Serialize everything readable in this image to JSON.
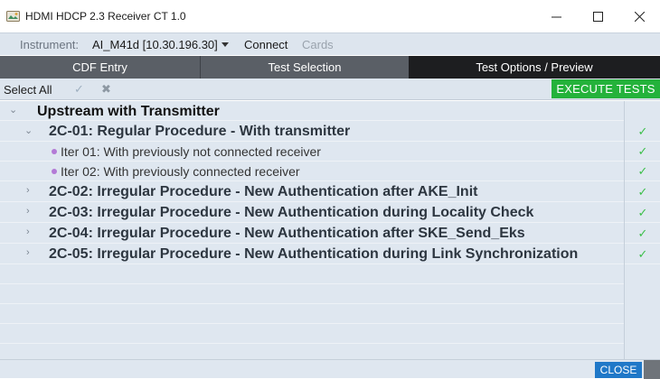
{
  "window": {
    "title": "HDMI HDCP 2.3 Receiver CT 1.0",
    "minimize_glyph": "—",
    "maximize_glyph": "☐",
    "close_glyph": "✕"
  },
  "instrument_bar": {
    "label": "Instrument:",
    "value": "AI_M41d [10.30.196.30]",
    "connect_label": "Connect",
    "cards_label": "Cards"
  },
  "tabs": [
    {
      "label": "CDF Entry"
    },
    {
      "label": "Test Selection"
    },
    {
      "label": "Test Options / Preview"
    }
  ],
  "toolbar": {
    "select_all_label": "Select All",
    "check_glyph": "✓",
    "x_glyph": "✖",
    "execute_label": "EXECUTE TESTS"
  },
  "tree": {
    "group": {
      "chevron": "⌄",
      "label": "Upstream with Transmitter"
    },
    "items": [
      {
        "chevron": "⌄",
        "label": "2C-01: Regular Procedure - With transmitter",
        "status": "✓"
      },
      {
        "bullet": true,
        "label": "Iter 01: With previously not connected receiver",
        "status": "✓"
      },
      {
        "bullet": true,
        "label": "Iter 02: With previously connected receiver",
        "status": "✓"
      },
      {
        "chevron": "›",
        "label": "2C-02: Irregular Procedure - New Authentication after AKE_Init",
        "status": "✓"
      },
      {
        "chevron": "›",
        "label": "2C-03: Irregular Procedure - New Authentication during Locality Check",
        "status": "✓"
      },
      {
        "chevron": "›",
        "label": "2C-04: Irregular Procedure - New Authentication after SKE_Send_Eks",
        "status": "✓"
      },
      {
        "chevron": "›",
        "label": "2C-05: Irregular Procedure - New Authentication during Link Synchronization",
        "status": "✓"
      }
    ]
  },
  "footer": {
    "close_label": "CLOSE"
  },
  "colors": {
    "execute_green": "#24b23b",
    "close_blue": "#1f78c8",
    "check_green": "#3cbf4a",
    "active_tab": "#1d1e20",
    "inactive_tab": "#5a5f66"
  }
}
